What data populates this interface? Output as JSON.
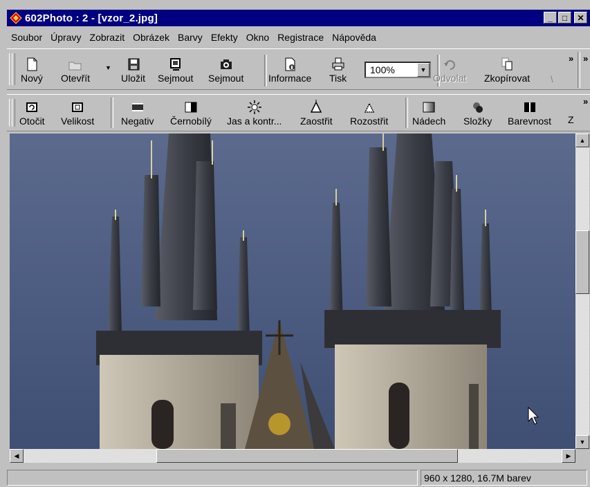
{
  "window": {
    "title": "602Photo : 2 - [vzor_2.jpg]"
  },
  "window_buttons": {
    "minimize": "_",
    "maximize": "□",
    "close": "✕"
  },
  "menu": [
    {
      "label": "Soubor",
      "icon": ""
    },
    {
      "label": "Úpravy"
    },
    {
      "label": "Zobrazit"
    },
    {
      "label": "Obrázek"
    },
    {
      "label": "Barvy"
    },
    {
      "label": "Efekty"
    },
    {
      "label": "Okno"
    },
    {
      "label": "Registrace"
    },
    {
      "label": "Nápověda"
    }
  ],
  "toolbar1": {
    "new": "Nový",
    "open": "Otevřít",
    "save": "Uložit",
    "capture1": "Sejmout",
    "capture2": "Sejmout",
    "info": "Informace",
    "print": "Tisk",
    "zoom": "100%",
    "undo": "Odvolat",
    "copy": "Zkopírovat",
    "overflow": "»"
  },
  "toolbar2": {
    "rotate": "Otočit",
    "size": "Velikost",
    "negative": "Negativ",
    "bw": "Černobílý",
    "brightness": "Jas a kontr...",
    "sharpen": "Zaostřit",
    "blur": "Rozostřit",
    "tint": "Nádech",
    "components": "Složky",
    "color": "Barevnost",
    "more": "Z",
    "overflow": "»"
  },
  "status": {
    "left": "",
    "right": "960 x 1280, 16.7M barev"
  },
  "colors": {
    "title_bar": "#000080",
    "chrome": "#c0c0c0",
    "sky": "#4a5a7e"
  },
  "icons": {
    "app": "app-diamond-icon",
    "new": "new-document-icon",
    "open": "open-folder-icon",
    "save": "floppy-disk-icon",
    "capture": "scanner-icon",
    "camera": "camera-icon",
    "info": "info-document-icon",
    "print": "printer-icon",
    "undo": "undo-icon",
    "copy": "copy-icon",
    "rotate": "rotate-icon",
    "size": "resize-icon",
    "negative": "negative-icon",
    "bw": "black-white-icon",
    "brightness": "sun-icon",
    "sharpen": "sharpen-icon",
    "blur": "blur-icon",
    "tint": "tint-icon",
    "components": "components-icon",
    "color": "color-icon",
    "cursor": "mouse-pointer-icon"
  }
}
